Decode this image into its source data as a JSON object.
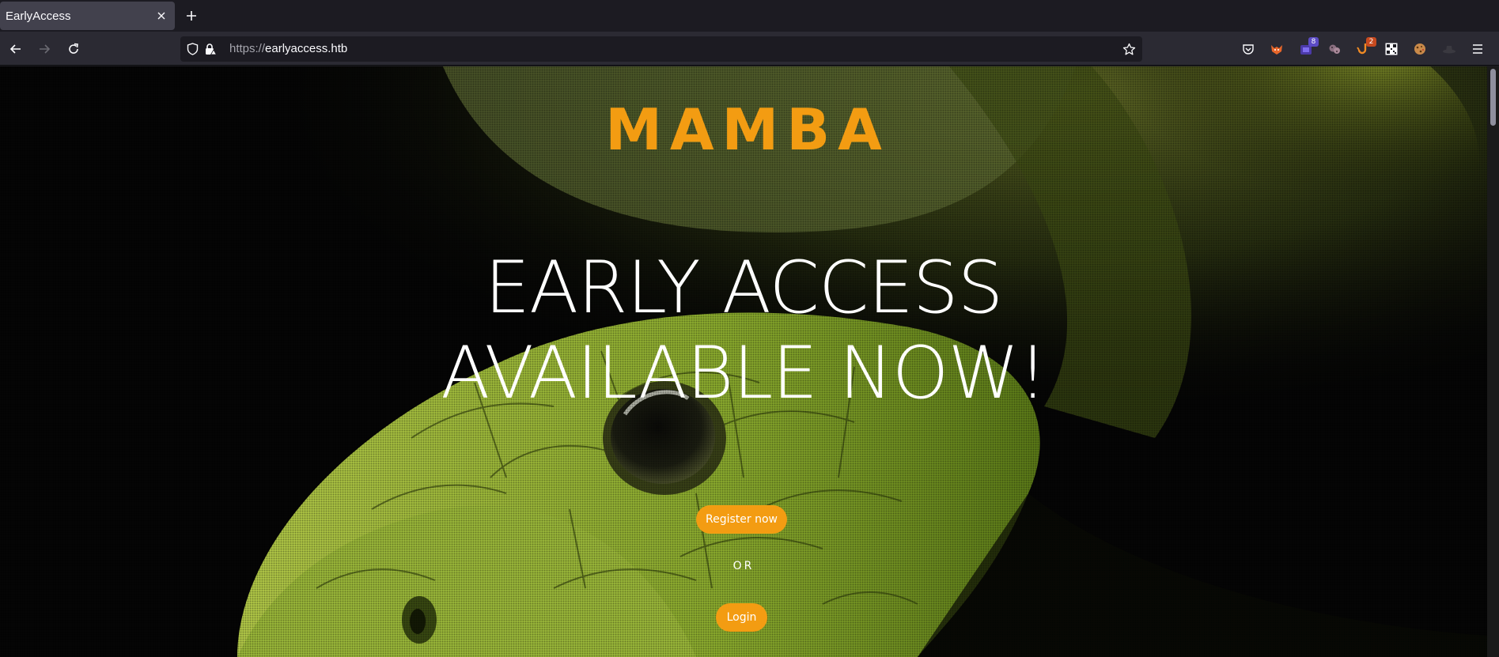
{
  "browser": {
    "tab_title": "EarlyAccess",
    "url_scheme": "https://",
    "url_host": "earlyaccess.htb",
    "extensions": [
      {
        "name": "pocket-icon",
        "badge": ""
      },
      {
        "name": "foxyproxy-icon",
        "badge": ""
      },
      {
        "name": "extension-purple-icon",
        "badge": "8"
      },
      {
        "name": "cookie-editor-icon",
        "badge": ""
      },
      {
        "name": "hook-extension-icon",
        "badge": "2"
      },
      {
        "name": "qr-code-icon",
        "badge": ""
      },
      {
        "name": "cookie-icon",
        "badge": ""
      },
      {
        "name": "hat-icon",
        "badge": ""
      }
    ]
  },
  "page": {
    "brand": "MAMBA",
    "headline_line1": "EARLY ACCESS",
    "headline_line2": "AVAILABLE NOW!",
    "register_label": "Register now",
    "or_label": "OR",
    "login_label": "Login"
  },
  "colors": {
    "accent": "#f39c12",
    "chrome_dark": "#1c1b22",
    "chrome_toolbar": "#2b2a33"
  }
}
